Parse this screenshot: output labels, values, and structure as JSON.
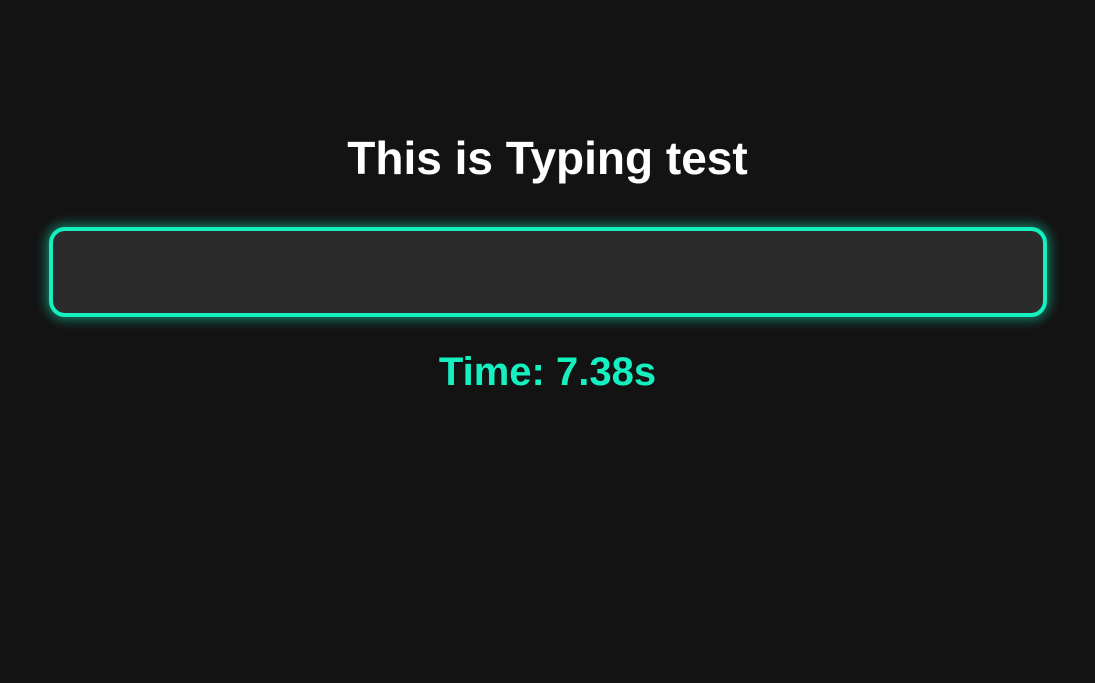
{
  "page": {
    "title": "This is Typing test"
  },
  "typing_input": {
    "value": "",
    "placeholder": ""
  },
  "timer": {
    "text": "Time: 7.38s"
  },
  "colors": {
    "background": "#131313",
    "input_background": "#2b2b2b",
    "accent": "#14f0c0",
    "title_text": "#ffffff"
  }
}
